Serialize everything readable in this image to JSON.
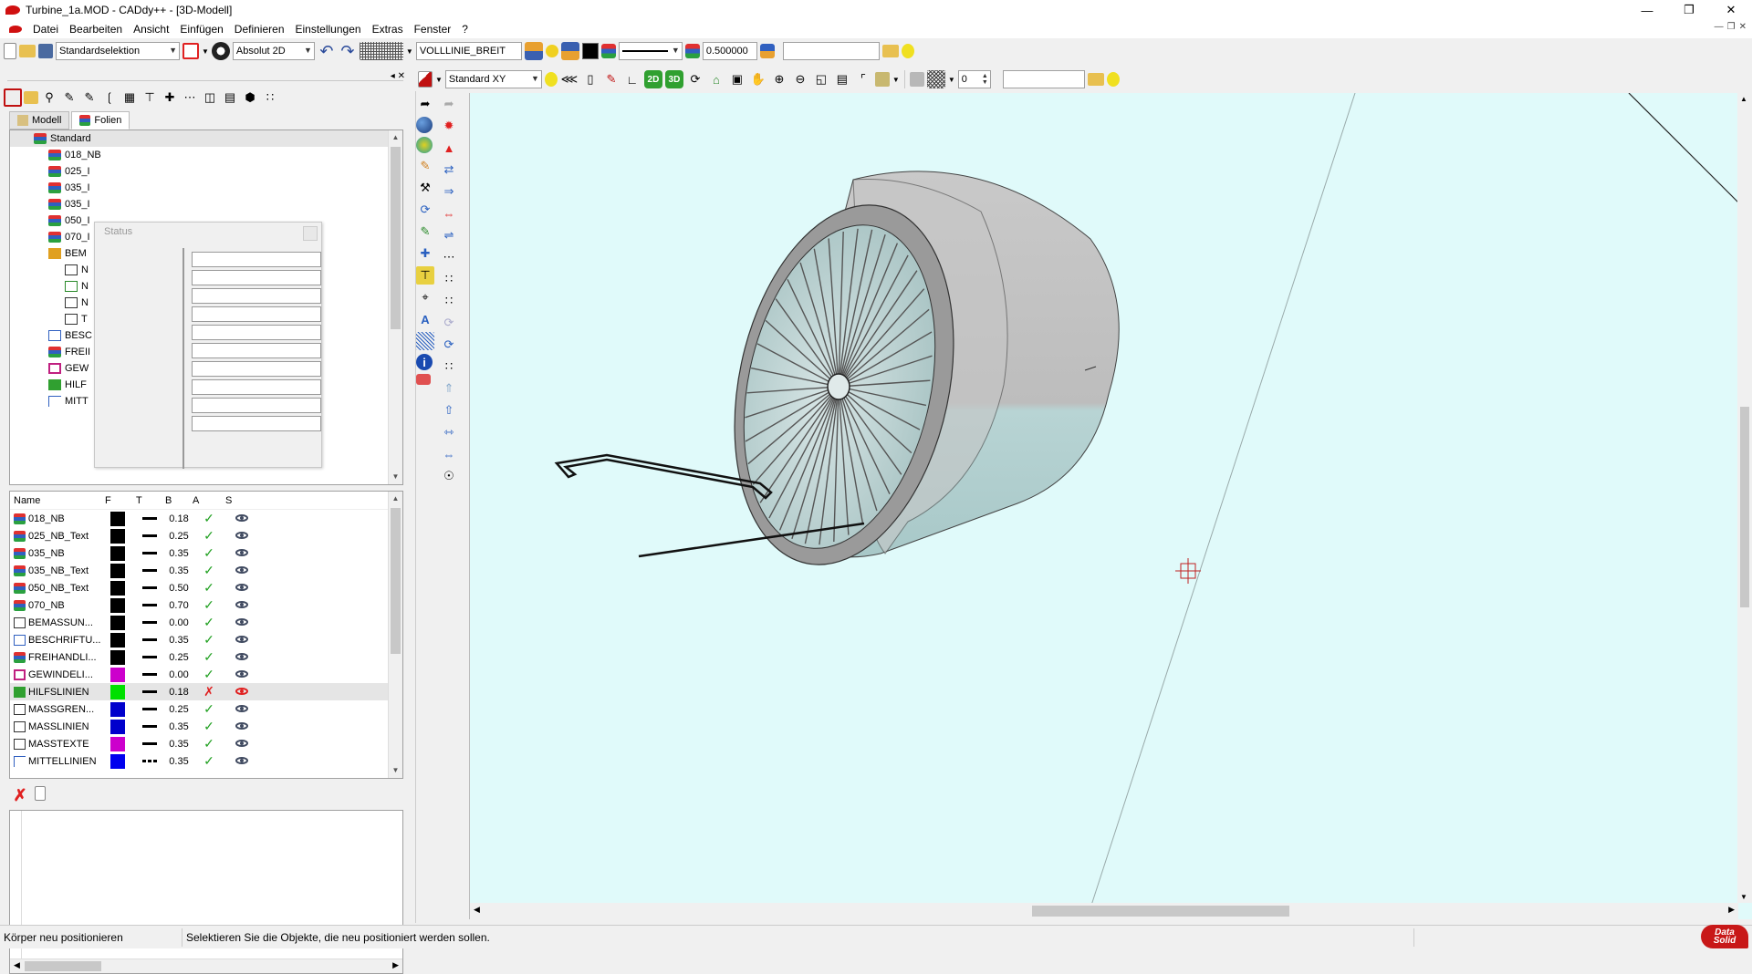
{
  "window": {
    "title": "Turbine_1a.MOD  -  CADdy++ - [3D-Modell]"
  },
  "menu": [
    "Datei",
    "Bearbeiten",
    "Ansicht",
    "Einfügen",
    "Definieren",
    "Einstellungen",
    "Extras",
    "Fenster",
    "?"
  ],
  "toolbar1": {
    "selection_mode": "Standardselektion",
    "coord_mode": "Absolut 2D",
    "linetype": "VOLLLINIE_BREIT",
    "line_width": "0.500000",
    "text_field": ""
  },
  "toolbar2": {
    "view_plane": "Standard XY",
    "btn_2d": "2D",
    "btn_3d": "3D",
    "spin_value": "0",
    "text_field": ""
  },
  "tabs": {
    "model": "Modell",
    "layers": "Folien"
  },
  "tree": {
    "root": "Standard",
    "items": [
      "018_NB",
      "025_I",
      "035_I",
      "035_I",
      "050_I",
      "070_I",
      "BEM",
      "N",
      "N",
      "N",
      "T",
      "BESC",
      "FREII",
      "GEW",
      "HILF",
      "MITT"
    ]
  },
  "status_popup": {
    "title": "Status"
  },
  "layer_table": {
    "headers": [
      "Name",
      "F",
      "T",
      "B",
      "A",
      "S"
    ],
    "rows": [
      {
        "name": "018_NB",
        "color": "#000000",
        "line": "solid",
        "width": "0.18",
        "active": true,
        "visible": true,
        "icon": "layer"
      },
      {
        "name": "025_NB_Text",
        "color": "#000000",
        "line": "solid",
        "width": "0.25",
        "active": true,
        "visible": true,
        "icon": "layer"
      },
      {
        "name": "035_NB",
        "color": "#000000",
        "line": "solid",
        "width": "0.35",
        "active": true,
        "visible": true,
        "icon": "layer"
      },
      {
        "name": "035_NB_Text",
        "color": "#000000",
        "line": "solid",
        "width": "0.35",
        "active": true,
        "visible": true,
        "icon": "layer"
      },
      {
        "name": "050_NB_Text",
        "color": "#000000",
        "line": "solid",
        "width": "0.50",
        "active": true,
        "visible": true,
        "icon": "layer"
      },
      {
        "name": "070_NB",
        "color": "#000000",
        "line": "solid",
        "width": "0.70",
        "active": true,
        "visible": true,
        "icon": "layer"
      },
      {
        "name": "BEMASSUN...",
        "color": "#000000",
        "line": "solid",
        "width": "0.00",
        "active": true,
        "visible": true,
        "icon": "dim"
      },
      {
        "name": "BESCHRIFTU...",
        "color": "#000000",
        "line": "solid",
        "width": "0.35",
        "active": true,
        "visible": true,
        "icon": "text"
      },
      {
        "name": "FREIHANDLI...",
        "color": "#000000",
        "line": "solid",
        "width": "0.25",
        "active": true,
        "visible": true,
        "icon": "layer"
      },
      {
        "name": "GEWINDELI...",
        "color": "#cc00cc",
        "line": "solid",
        "width": "0.00",
        "active": true,
        "visible": true,
        "icon": "thread"
      },
      {
        "name": "HILFSLINIEN",
        "color": "#00e000",
        "line": "solid",
        "width": "0.18",
        "active": false,
        "visible": false,
        "icon": "aux",
        "selected": true
      },
      {
        "name": "MASSGREN...",
        "color": "#0000cc",
        "line": "solid",
        "width": "0.25",
        "active": true,
        "visible": true,
        "icon": "dim"
      },
      {
        "name": "MASSLINIEN",
        "color": "#0000cc",
        "line": "solid",
        "width": "0.35",
        "active": true,
        "visible": true,
        "icon": "dim"
      },
      {
        "name": "MASSTEXTE",
        "color": "#cc00cc",
        "line": "solid",
        "width": "0.35",
        "active": true,
        "visible": true,
        "icon": "dim"
      },
      {
        "name": "MITTELLINIEN",
        "color": "#0000ee",
        "line": "dash",
        "width": "0.35",
        "active": true,
        "visible": true,
        "icon": "center"
      }
    ]
  },
  "statusbar": {
    "command": "Körper neu positionieren",
    "prompt": "Selektieren Sie die Objekte, die neu positioniert werden sollen."
  },
  "brand": {
    "line1": "Data",
    "line2": "Solid"
  },
  "colors": {
    "viewport_bg": "#e0fafa",
    "accent_red": "#d01010"
  }
}
